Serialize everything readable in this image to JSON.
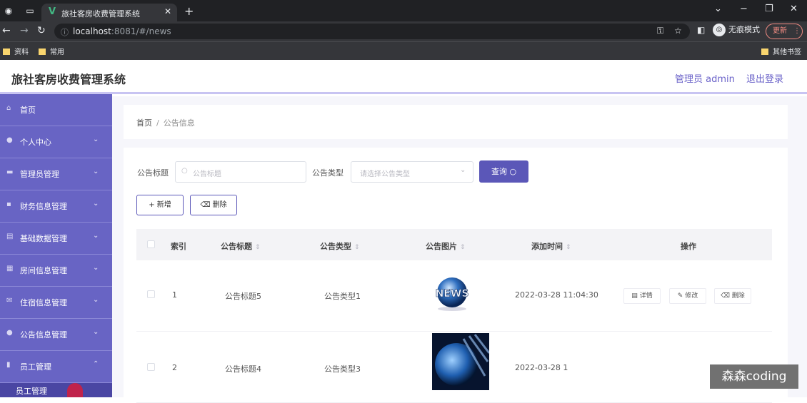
{
  "browser": {
    "tab_title": "旅社客房收费管理系统",
    "url_host": "localhost",
    "url_rest": ":8081/#/news",
    "incognito_label": "无痕模式",
    "update_label": "更新",
    "bookmarks": [
      "资料",
      "常用"
    ],
    "other_bookmarks": "其他书签"
  },
  "header": {
    "title": "旅社客房收费管理系统",
    "admin": "管理员 admin",
    "logout": "退出登录"
  },
  "sidebar": {
    "items": [
      {
        "label": "首页",
        "icon": "home-icon"
      },
      {
        "label": "个人中心",
        "icon": "user-icon"
      },
      {
        "label": "管理员管理",
        "icon": "manage-icon"
      },
      {
        "label": "财务信息管理",
        "icon": "finance-icon"
      },
      {
        "label": "基础数据管理",
        "icon": "data-icon"
      },
      {
        "label": "房间信息管理",
        "icon": "grid-icon"
      },
      {
        "label": "住宿信息管理",
        "icon": "mail-icon"
      },
      {
        "label": "公告信息管理",
        "icon": "user-icon"
      },
      {
        "label": "员工管理",
        "icon": "chart-icon"
      }
    ],
    "submenu_label": "员工管理"
  },
  "breadcrumb": {
    "home": "首页",
    "sep": "/",
    "current": "公告信息"
  },
  "search": {
    "title_label": "公告标题",
    "title_placeholder": "公告标题",
    "type_label": "公告类型",
    "type_placeholder": "请选择公告类型",
    "query_label": "查询"
  },
  "actions": {
    "add_label": "新增",
    "delete_label": "删除"
  },
  "table": {
    "headers": [
      "索引",
      "公告标题",
      "公告类型",
      "公告图片",
      "添加时间",
      "操作"
    ],
    "rows": [
      {
        "index": "1",
        "title": "公告标题5",
        "type": "公告类型1",
        "time": "2022-03-28 11:04:30"
      },
      {
        "index": "2",
        "title": "公告标题4",
        "type": "公告类型3",
        "time": "2022-03-28 1"
      }
    ],
    "op_labels": {
      "detail": "详情",
      "edit": "修改",
      "delete": "删除"
    }
  },
  "watermark": "森森coding",
  "colors": {
    "primary": "#5b57b8",
    "sidebar": "#6864c4",
    "chrome": "#202124"
  }
}
